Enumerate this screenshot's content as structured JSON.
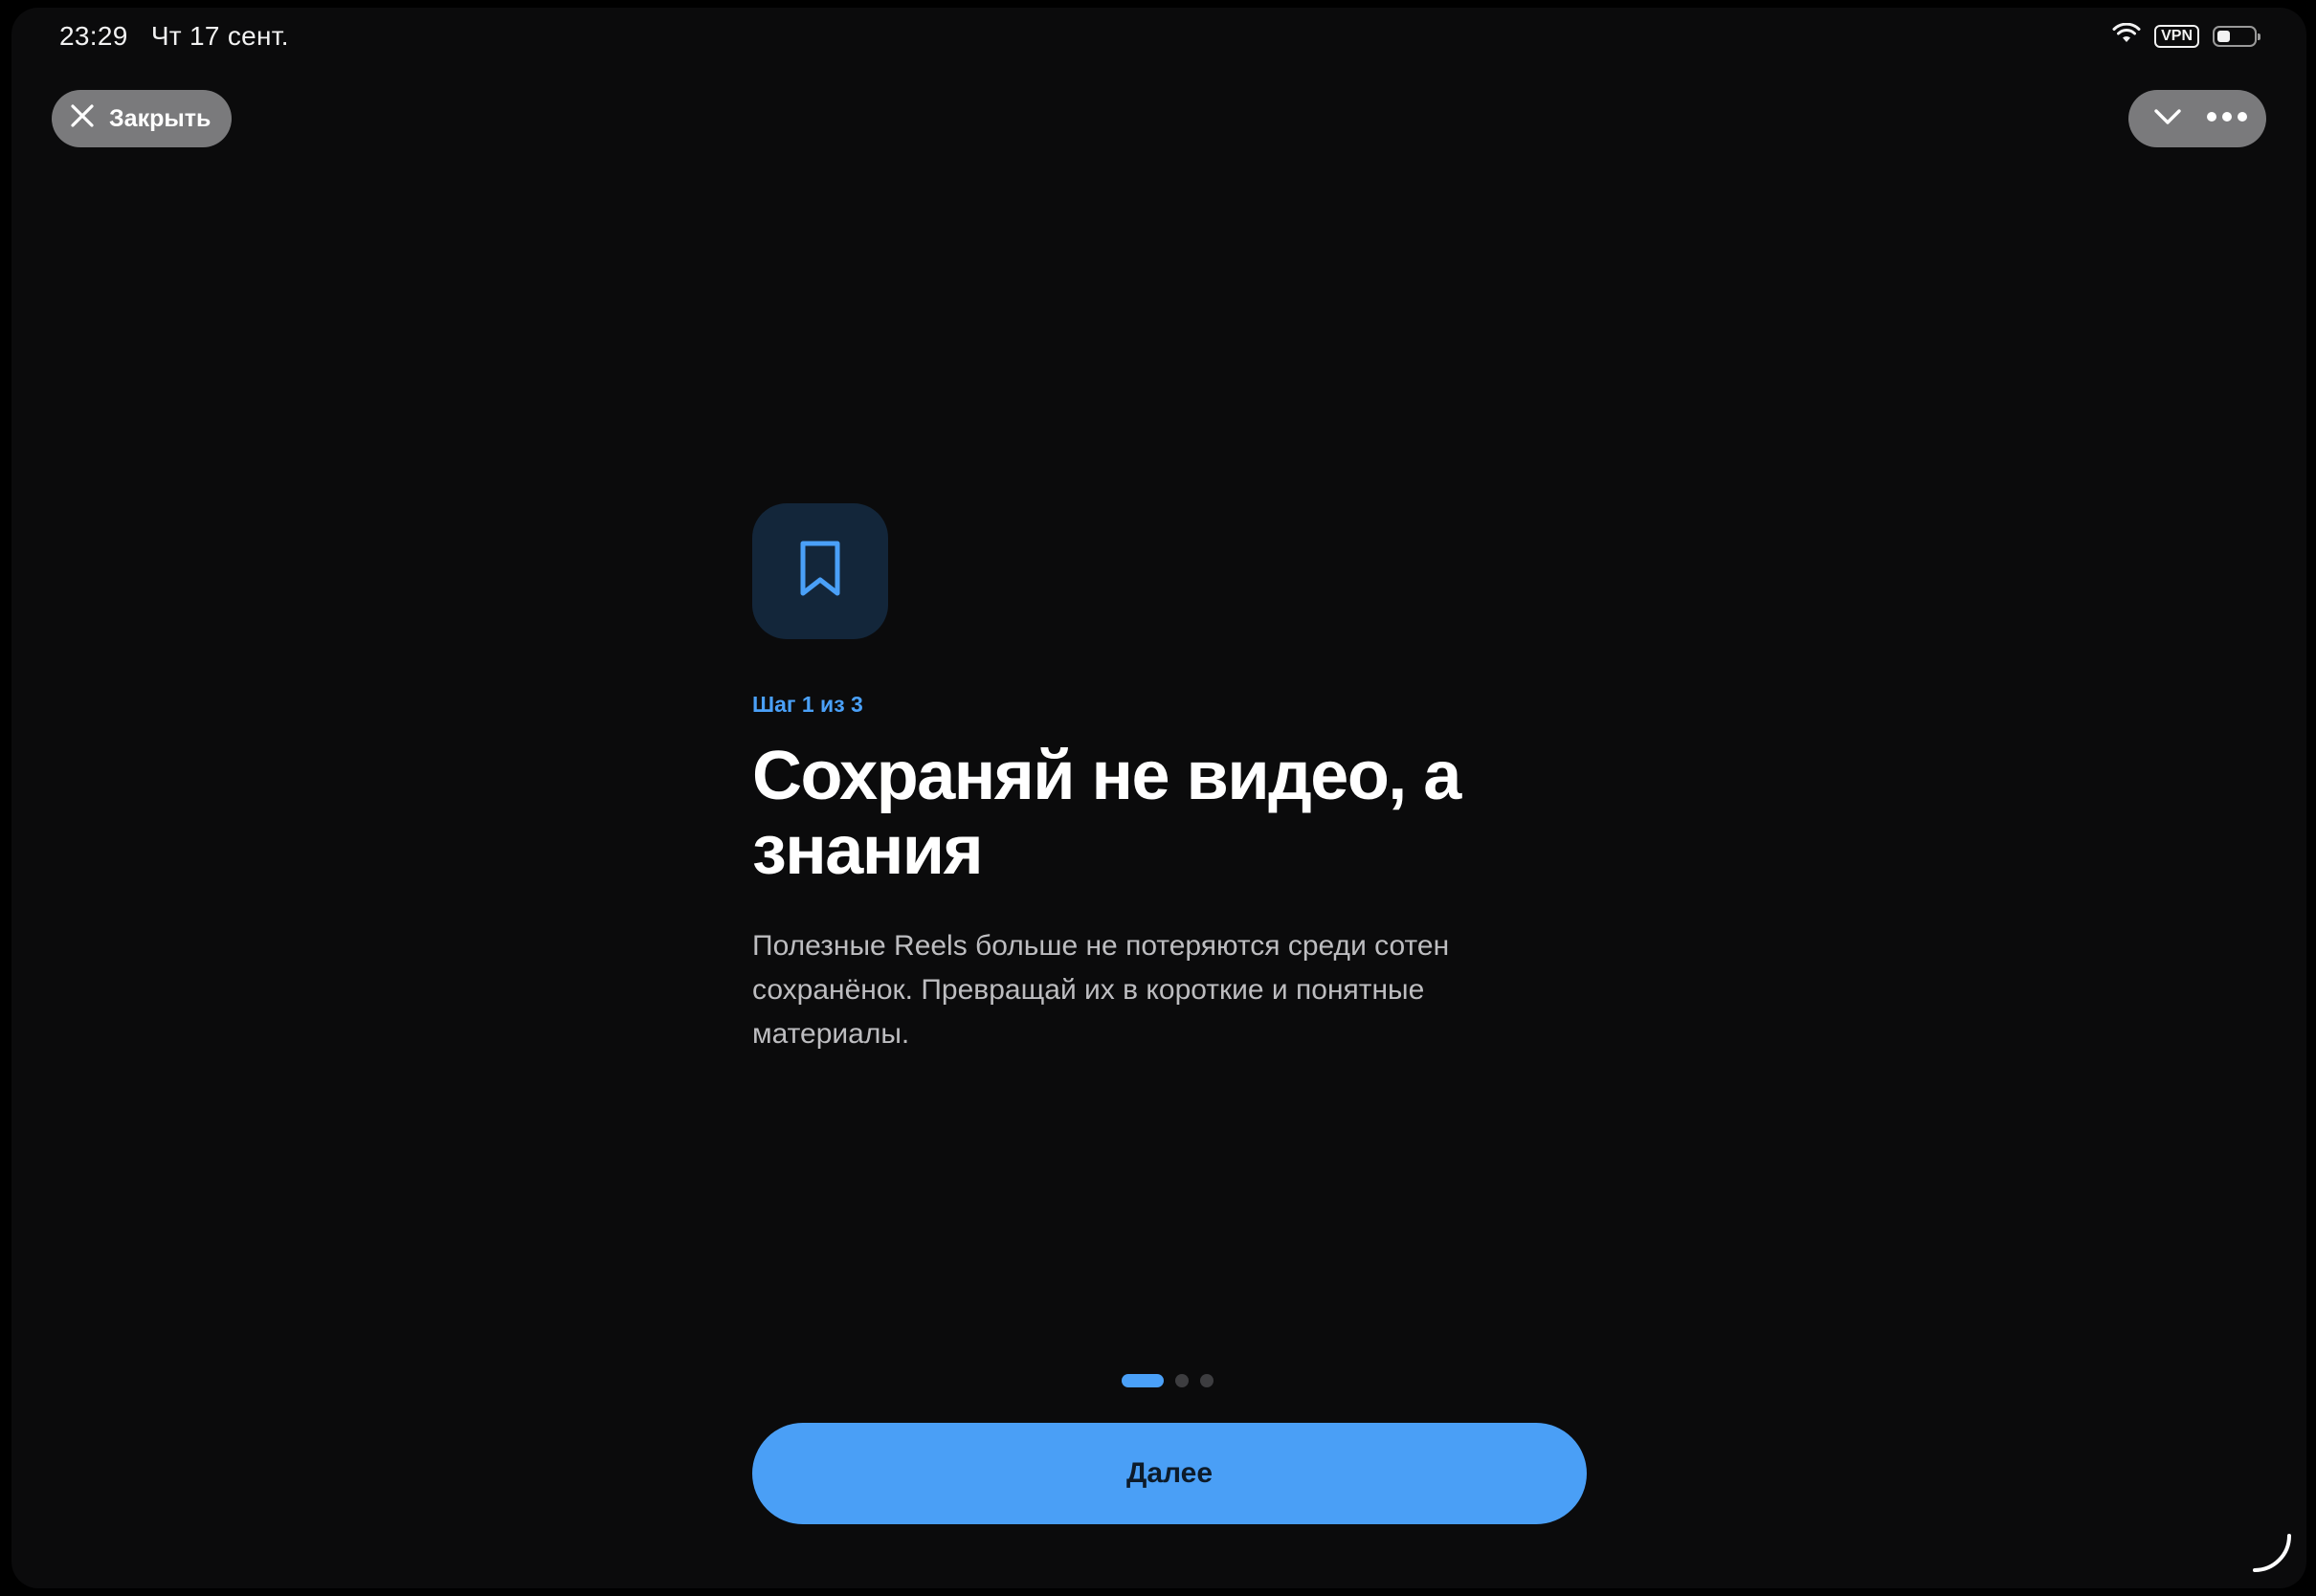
{
  "status_bar": {
    "time": "23:29",
    "date": "Чт 17 сент.",
    "vpn_label": "VPN",
    "battery_level": 0.35,
    "wifi_icon": "wifi-icon"
  },
  "header": {
    "close_label": "Закрыть",
    "close_icon": "close-icon",
    "collapse_icon": "chevron-down-icon",
    "more_icon": "more-icon"
  },
  "onboarding": {
    "icon": "bookmark-icon",
    "step_label": "Шаг 1 из 3",
    "title": "Сохраняй не видео, а знания",
    "description": "Полезные Reels больше не потеряются среди сотен сохранёнок. Превращай их в короткие и понятные материалы.",
    "current_step": 1,
    "total_steps": 3
  },
  "footer": {
    "next_label": "Далее"
  },
  "colors": {
    "accent": "#4a9ff6",
    "background": "#0b0b0c",
    "icon_tile": "#13263a",
    "pill": "#7a7a7c"
  }
}
